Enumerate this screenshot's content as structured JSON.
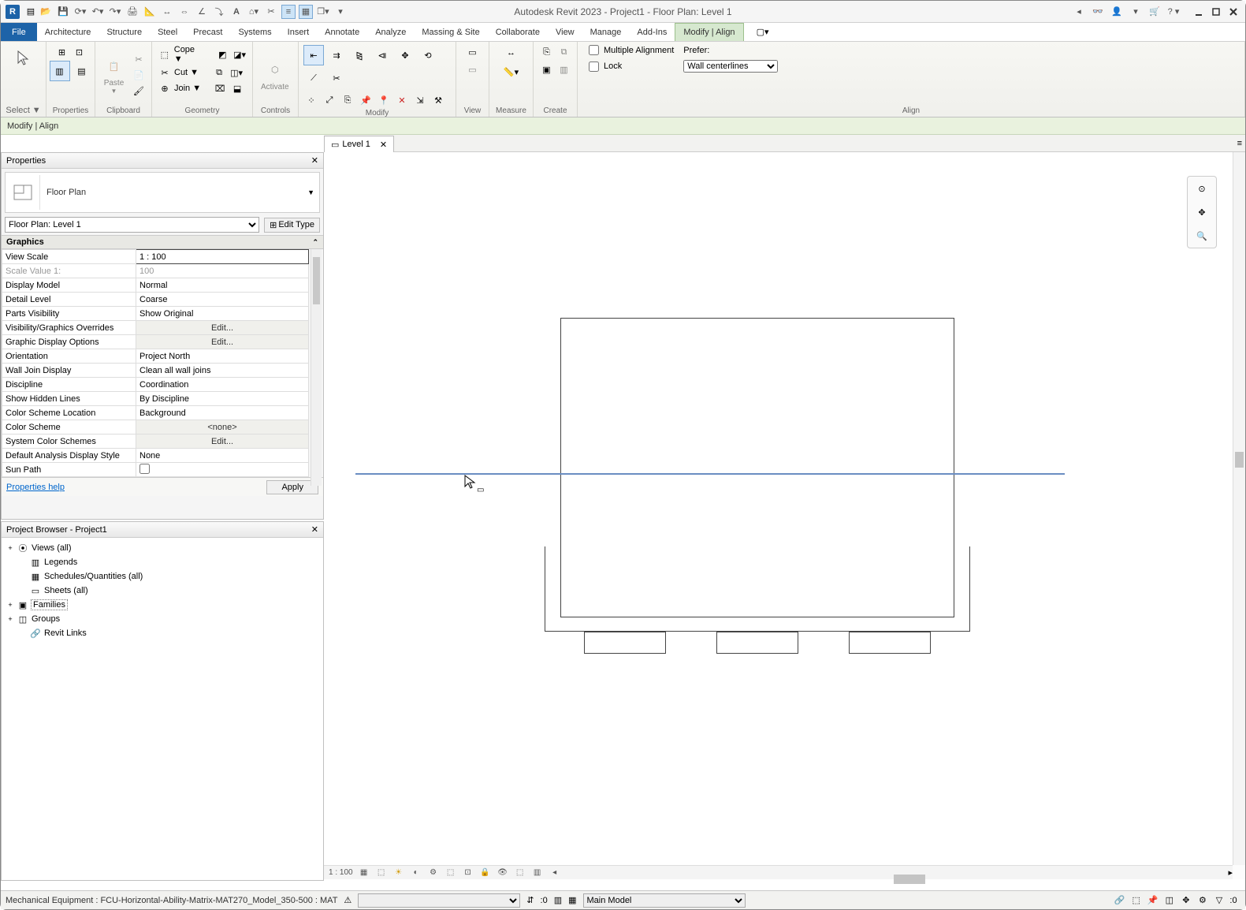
{
  "title": "Autodesk Revit 2023 - Project1 - Floor Plan: Level 1",
  "qat": [
    "recent",
    "open",
    "save",
    "saveas",
    "undo",
    "redo",
    "print",
    "!",
    "measure",
    "dimlin",
    "dimang",
    "dimtgt",
    "text",
    "3d",
    "section",
    "thin",
    "switch",
    "close",
    "more"
  ],
  "title_right": [
    "left",
    "binoc",
    "user",
    "more",
    "cart",
    "help"
  ],
  "ribbon_tabs": [
    "File",
    "Architecture",
    "Structure",
    "Steel",
    "Precast",
    "Systems",
    "Insert",
    "Annotate",
    "Analyze",
    "Massing & Site",
    "Collaborate",
    "View",
    "Manage",
    "Add-Ins",
    "Modify | Align"
  ],
  "ribbon_active": 14,
  "subbar": "Modify | Align",
  "panels": {
    "select": {
      "label": "Select",
      "down": "▼"
    },
    "properties": {
      "label": "Properties"
    },
    "clipboard": {
      "label": "Clipboard",
      "paste": "Paste",
      "cope": "Cope ▼",
      "cut": "Cut ▼",
      "join": "Join ▼"
    },
    "geometry": {
      "label": "Geometry"
    },
    "controls": {
      "label": "Controls",
      "activate": "Activate"
    },
    "modify": {
      "label": "Modify"
    },
    "view": {
      "label": "View"
    },
    "measure": {
      "label": "Measure"
    },
    "create": {
      "label": "Create"
    },
    "align": {
      "label": "Align",
      "mult": "Multiple Alignment",
      "lock": "Lock",
      "prefer": "Prefer:",
      "prefer_val": "Wall centerlines"
    }
  },
  "properties": {
    "title": "Properties",
    "type_selector": "Floor Plan",
    "instance": "Floor Plan: Level 1",
    "edit_type": "Edit Type",
    "group": "Graphics",
    "rows": [
      {
        "k": "View Scale",
        "v": "1 : 100",
        "inp": true
      },
      {
        "k": "Scale Value    1:",
        "v": "100",
        "ro": true
      },
      {
        "k": "Display Model",
        "v": "Normal"
      },
      {
        "k": "Detail Level",
        "v": "Coarse"
      },
      {
        "k": "Parts Visibility",
        "v": "Show Original"
      },
      {
        "k": "Visibility/Graphics Overrides",
        "v": "Edit...",
        "btn": true
      },
      {
        "k": "Graphic Display Options",
        "v": "Edit...",
        "btn": true
      },
      {
        "k": "Orientation",
        "v": "Project North"
      },
      {
        "k": "Wall Join Display",
        "v": "Clean all wall joins"
      },
      {
        "k": "Discipline",
        "v": "Coordination"
      },
      {
        "k": "Show Hidden Lines",
        "v": "By Discipline"
      },
      {
        "k": "Color Scheme Location",
        "v": "Background"
      },
      {
        "k": "Color Scheme",
        "v": "<none>",
        "btn": true
      },
      {
        "k": "System Color Schemes",
        "v": "Edit...",
        "btn": true
      },
      {
        "k": "Default Analysis Display Style",
        "v": "None"
      },
      {
        "k": "Sun Path",
        "v": "",
        "chk": true
      }
    ],
    "help": "Properties help",
    "apply": "Apply"
  },
  "browser": {
    "title": "Project Browser - Project1",
    "items": [
      {
        "l": "Views (all)",
        "exp": "+",
        "ic": "views",
        "lvl": 0
      },
      {
        "l": "Legends",
        "ic": "legend",
        "lvl": 1
      },
      {
        "l": "Schedules/Quantities (all)",
        "ic": "sched",
        "lvl": 1
      },
      {
        "l": "Sheets (all)",
        "ic": "sheet",
        "lvl": 1
      },
      {
        "l": "Families",
        "exp": "+",
        "ic": "fam",
        "lvl": 0,
        "sel": true
      },
      {
        "l": "Groups",
        "exp": "+",
        "ic": "grp",
        "lvl": 0
      },
      {
        "l": "Revit Links",
        "ic": "link",
        "lvl": 1
      }
    ]
  },
  "view_tab": "Level 1",
  "view_scale": "1 : 100",
  "status": {
    "msg": "Mechanical Equipment : FCU-Horizontal-Ability-Matrix-MAT270_Model_350-500 : MAT",
    "press": ":0",
    "main": "Main Model",
    "filter": ":0"
  }
}
